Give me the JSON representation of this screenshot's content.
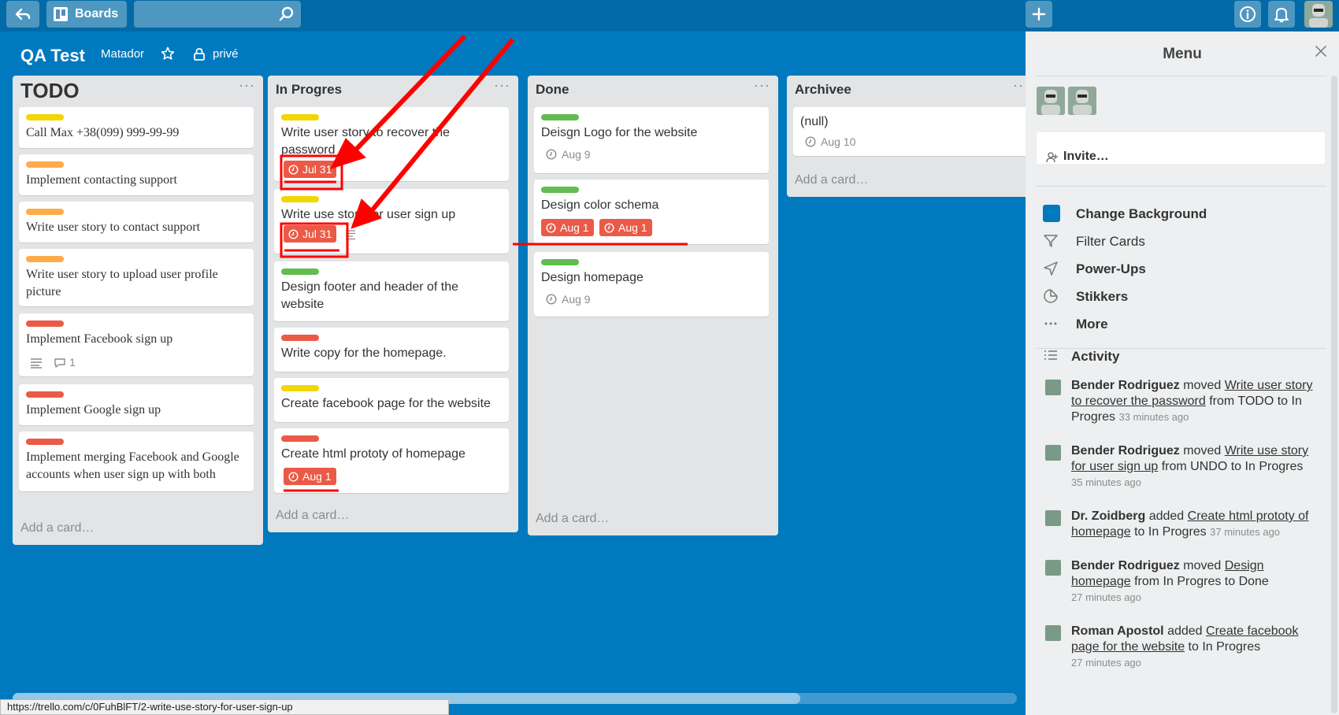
{
  "topbar": {
    "back_icon": "back-arrow-icon",
    "boards_label": "Boards",
    "search_placeholder": "",
    "add_icon": "plus-icon",
    "info_icon": "info-icon",
    "notifications_icon": "bell-icon"
  },
  "board": {
    "title": "QA Test",
    "org": "Matador",
    "visibility": "privé"
  },
  "lists": [
    {
      "title": "TODO",
      "cards": [
        {
          "label_color": "#f2d600",
          "text": "Call Max +38(099) 999-99-99"
        },
        {
          "label_color": "#ffab4a",
          "text": "Implement contacting support"
        },
        {
          "label_color": "#ffab4a",
          "text": "Write user story to contact support"
        },
        {
          "label_color": "#ffab4a",
          "text": "Write user story to upload user profile picture"
        },
        {
          "label_color": "#eb5a46",
          "text": "Implement Facebook sign up",
          "comments": "1"
        },
        {
          "label_color": "#eb5a46",
          "text": "Implement Google sign up"
        },
        {
          "label_color": "#eb5a46",
          "text": "Implement merging Facebook and Google accounts when user sign up with both"
        }
      ],
      "add_card": "Add a card…"
    },
    {
      "title": "In Progres",
      "cards": [
        {
          "label_color": "#f2d600",
          "text": "Write user story to recover the password",
          "due": "Jul 31"
        },
        {
          "label_color": "#f2d600",
          "text": "Write use story for user sign up",
          "due": "Jul 31"
        },
        {
          "label_color": "#61bd4f",
          "text": "Design footer and header of the website"
        },
        {
          "label_color": "#eb5a46",
          "text": "Write copy for the homepage."
        },
        {
          "label_color": "#f2d600",
          "text": "Create facebook page for the website"
        },
        {
          "label_color": "#eb5a46",
          "text": "Create html prototy of homepage",
          "due": "Aug 1"
        }
      ],
      "add_card": "Add a card…"
    },
    {
      "title": "Done",
      "cards": [
        {
          "label_color": "#61bd4f",
          "text": "Deisgn Logo for the website",
          "due": "Aug 9"
        },
        {
          "label_color": "#61bd4f",
          "text": "Design color schema",
          "due": "Aug 1",
          "due2": "Aug 1"
        },
        {
          "label_color": "#61bd4f",
          "text": "Design homepage",
          "due": "Aug 9"
        }
      ],
      "add_card": "Add a card…"
    },
    {
      "title": "Archivee",
      "cards": [
        {
          "text": "(null)",
          "due": "Aug 10"
        }
      ],
      "add_card": "Add a card…"
    }
  ],
  "sidebar": {
    "title": "Menu",
    "invite": "Invite…",
    "items": [
      {
        "label": "Change Background",
        "icon": "background-swatch-icon",
        "color": "#0079bf"
      },
      {
        "label": "Filter Cards",
        "icon": "filter-icon"
      },
      {
        "label": "Power-Ups",
        "icon": "rocket-icon"
      },
      {
        "label": "Stikkers",
        "icon": "sticker-icon"
      },
      {
        "label": "More",
        "icon": "ellipsis-icon"
      }
    ],
    "activity_title": "Activity",
    "activity": [
      {
        "who": "Bender Rodriguez",
        "verb": "moved",
        "card": "Write user story to recover the password",
        "rest": "from TODO to In Progres",
        "time": "33 minutes ago"
      },
      {
        "who": "Bender Rodriguez",
        "verb": "moved",
        "card": "Write use story for user sign up",
        "rest": "from UNDO to In Progres",
        "time": "35 minutes ago"
      },
      {
        "who": "Dr. Zoidberg",
        "verb": "added",
        "card": "Create html prototy of homepage",
        "rest": "to In Progres",
        "time": "37 minutes ago"
      },
      {
        "who": "Bender Rodriguez",
        "verb": "moved",
        "card": "Design homepage",
        "rest": "from In Progres to Done",
        "time": "27 minutes ago"
      },
      {
        "who": "Roman Apostol",
        "verb": "added",
        "card": "Create facebook page for the website",
        "rest": "to In Progres",
        "time": "27 minutes ago"
      }
    ]
  },
  "statusbar": {
    "url": "https://trello.com/c/0FuhBlFT/2-write-use-story-for-user-sign-up"
  },
  "annotation_color": "#ff0000"
}
